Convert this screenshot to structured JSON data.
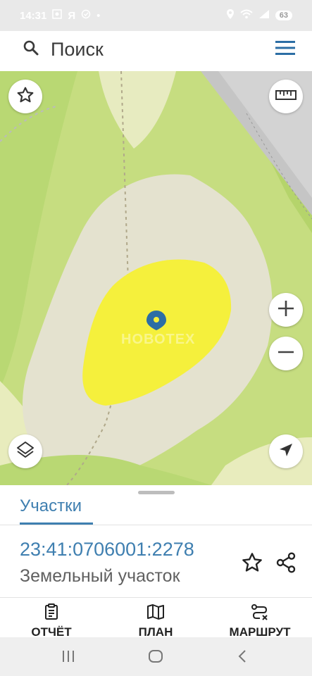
{
  "status_bar": {
    "time": "14:31",
    "carrier_glyph": "Я",
    "dot": "•",
    "battery": "63"
  },
  "search": {
    "placeholder": "Поиск"
  },
  "map": {
    "watermark": "НОВОТЕХ"
  },
  "sheet": {
    "tab_label": "Участки",
    "parcel_number": "23:41:0706001:2278",
    "parcel_type": "Земельный участок"
  },
  "actions": {
    "report_label": "ОТЧЁТ",
    "plan_label": "ПЛАН",
    "route_label": "МАРШРУТ"
  },
  "colors": {
    "accent": "#3f7fb0",
    "parcel_fill": "#f5f03c",
    "marker": "#2c6ea5"
  }
}
